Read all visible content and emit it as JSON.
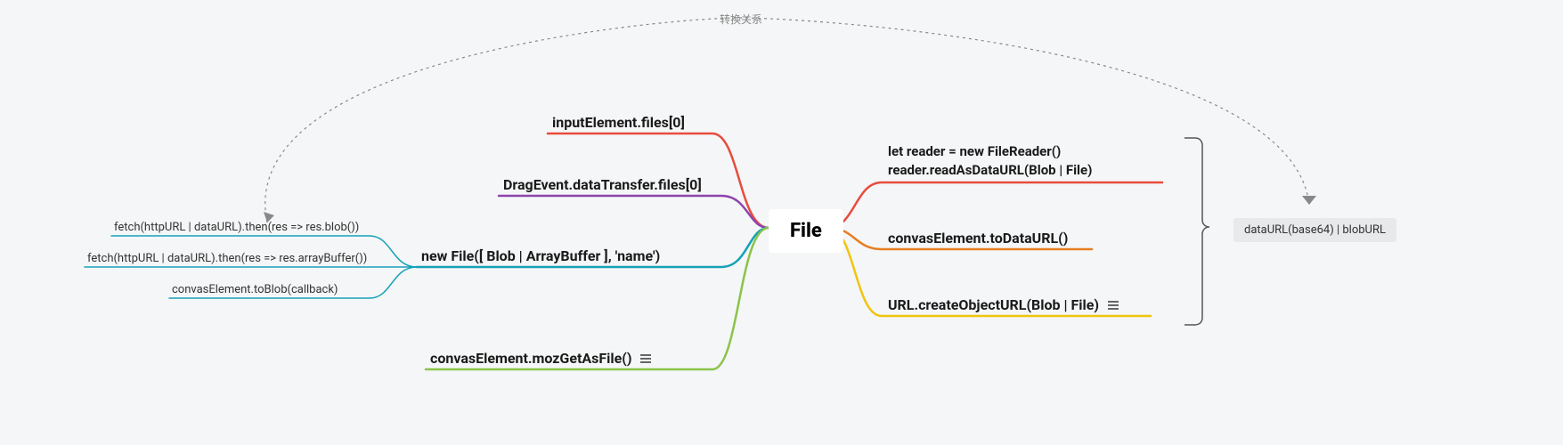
{
  "center": {
    "label": "File"
  },
  "left_branches": {
    "b1": {
      "label": "inputElement.files[0]",
      "color": "#e74c3c"
    },
    "b2": {
      "label": "DragEvent.dataTransfer.files[0]",
      "color": "#8e44ad"
    },
    "b3": {
      "label": "new File([ Blob | ArrayBuffer ], 'name')",
      "color": "#16a2b8",
      "children": {
        "c1": "fetch(httpURL | dataURL).then(res => res.blob())",
        "c2": "fetch(httpURL | dataURL).then(res => res.arrayBuffer())",
        "c3": "convasElement.toBlob(callback)"
      }
    },
    "b4": {
      "label": "convasElement.mozGetAsFile()",
      "color": "#8bc34a",
      "has_note": true
    }
  },
  "right_branches": {
    "r1": {
      "line1": "let reader = new FileReader()",
      "line2": "reader.readAsDataURL(Blob | File)",
      "color": "#e74c3c"
    },
    "r2": {
      "label": "convasElement.toDataURL()",
      "color": "#e67e22"
    },
    "r3": {
      "label": "URL.createObjectURL(Blob | File)",
      "color": "#f1c40f",
      "has_note": true
    }
  },
  "bracket_target": {
    "label": "dataURL(base64) | blobURL"
  },
  "annotation": {
    "label": "转换关系"
  }
}
